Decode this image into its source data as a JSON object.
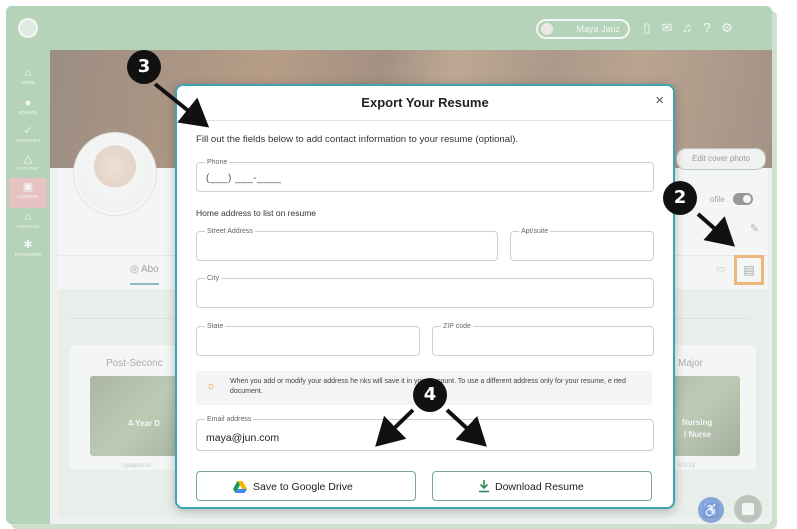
{
  "topbar": {
    "user_name": "Maya Jauz"
  },
  "nav": {
    "items": [
      {
        "label": "HOME",
        "icon": "home-icon"
      },
      {
        "label": "SCHOOL",
        "icon": "apple-icon"
      },
      {
        "label": "ACTIVITIES",
        "icon": "check-icon"
      },
      {
        "label": "EXPLORE",
        "icon": "compass-icon"
      },
      {
        "label": "CAREERS",
        "icon": "briefcase-icon"
      },
      {
        "label": "FINANCES",
        "icon": "bank-icon"
      },
      {
        "label": "PROGRAMS",
        "icon": "gear-icon"
      }
    ]
  },
  "profile": {
    "edit_cover_label": "Edit cover photo",
    "toggle_label": "ofile",
    "about_tab": "Abo"
  },
  "background_cards": {
    "left_title": "Post-Seconc",
    "left_image_text": "4-Year D",
    "left_sub": "Updated in",
    "right_title": "Major",
    "right_image_text_1": "Nursing",
    "right_image_text_2": "l Nurse",
    "right_sub": "5/1/23"
  },
  "modal": {
    "title": "Export Your Resume",
    "close_label": "×",
    "intro": "Fill out the fields below to add contact information to your resume (optional).",
    "phone": {
      "label": "Phone",
      "value": "(___) ___-____"
    },
    "address_heading": "Home address to list on resume",
    "street": {
      "label": "Street Address",
      "value": ""
    },
    "apt": {
      "label": "Apt/suite",
      "value": ""
    },
    "city": {
      "label": "City",
      "value": ""
    },
    "state": {
      "label": "State",
      "value": ""
    },
    "zip": {
      "label": "ZIP code",
      "value": ""
    },
    "info_text": "When you add or modify your address he nks will save it in your account. To use a different address only for your resume, e rted document.",
    "email": {
      "label": "Email address",
      "value": "maya@jun.com"
    },
    "save_drive_label": "Save to Google Drive",
    "download_label": "Download Resume"
  },
  "callouts": {
    "one": "3",
    "two": "2",
    "three": "4"
  },
  "colors": {
    "brand_green": "#8dbf93",
    "modal_border": "#3fa5b3",
    "highlight_orange": "#f08a24",
    "callout_black": "#111111"
  }
}
